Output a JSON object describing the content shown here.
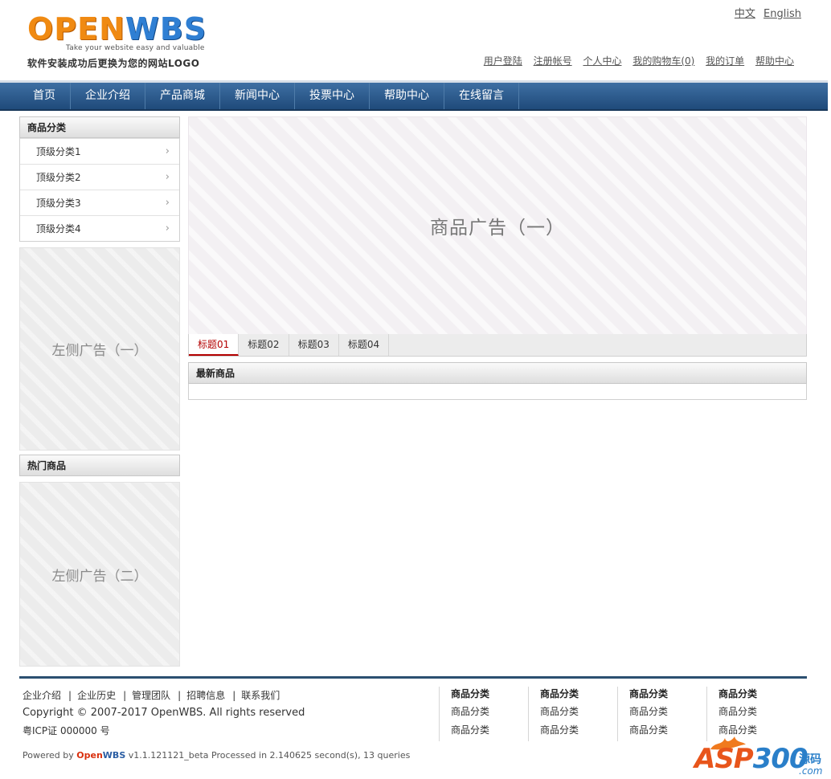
{
  "header": {
    "logo": {
      "word_o": "OPEN",
      "word_w": "WBS",
      "tagline": "Take your website easy and valuable",
      "subtitle": "软件安装成功后更换为您的网站LOGO"
    },
    "lang": [
      "中文",
      "English"
    ],
    "toplinks": [
      "用户登陆",
      "注册帐号",
      "个人中心",
      "我的购物车(0)",
      "我的订单",
      "帮助中心"
    ]
  },
  "nav": [
    "首页",
    "企业介绍",
    "产品商城",
    "新闻中心",
    "投票中心",
    "帮助中心",
    "在线留言"
  ],
  "sidebar": {
    "category_title": "商品分类",
    "categories": [
      "顶级分类1",
      "顶级分类2",
      "顶级分类3",
      "顶级分类4"
    ],
    "arrow": "›",
    "ad_left_1": "左侧广告（一）",
    "hot_title": "热门商品",
    "ad_left_2": "左侧广告（二）"
  },
  "main": {
    "ad_main": "商品广告（一）",
    "tabs": [
      "标题01",
      "标题02",
      "标题03",
      "标题04"
    ],
    "active_tab": 0,
    "new_title": "最新商品"
  },
  "footer": {
    "links": [
      "企业介绍",
      "企业历史",
      "管理团队",
      "招聘信息",
      "联系我们"
    ],
    "copyright": "Copyright © 2007-2017 OpenWBS. All rights reserved",
    "icp": "粤ICP证 000000 号",
    "powered_prefix": "Powered by ",
    "powered_open": "Open",
    "powered_wbs": "WBS",
    "powered_suffix": " v1.1.121121_beta Processed in 2.140625 second(s), 13 queries",
    "columns": [
      {
        "heading": "商品分类",
        "items": [
          "商品分类",
          "商品分类"
        ]
      },
      {
        "heading": "商品分类",
        "items": [
          "商品分类",
          "商品分类"
        ]
      },
      {
        "heading": "商品分类",
        "items": [
          "商品分类",
          "商品分类"
        ]
      },
      {
        "heading": "商品分类",
        "items": [
          "商品分类",
          "商品分类"
        ]
      }
    ]
  },
  "watermark": {
    "asp": "ASP",
    "num": "300",
    "side": "源码",
    "dotcom": ".com"
  },
  "colors": {
    "nav_bg": "#2f5c8c",
    "active_tab": "#b30000",
    "footer_rule": "#2b4f71",
    "logo_orange": "#f08a12",
    "logo_blue": "#2f7fd3"
  }
}
